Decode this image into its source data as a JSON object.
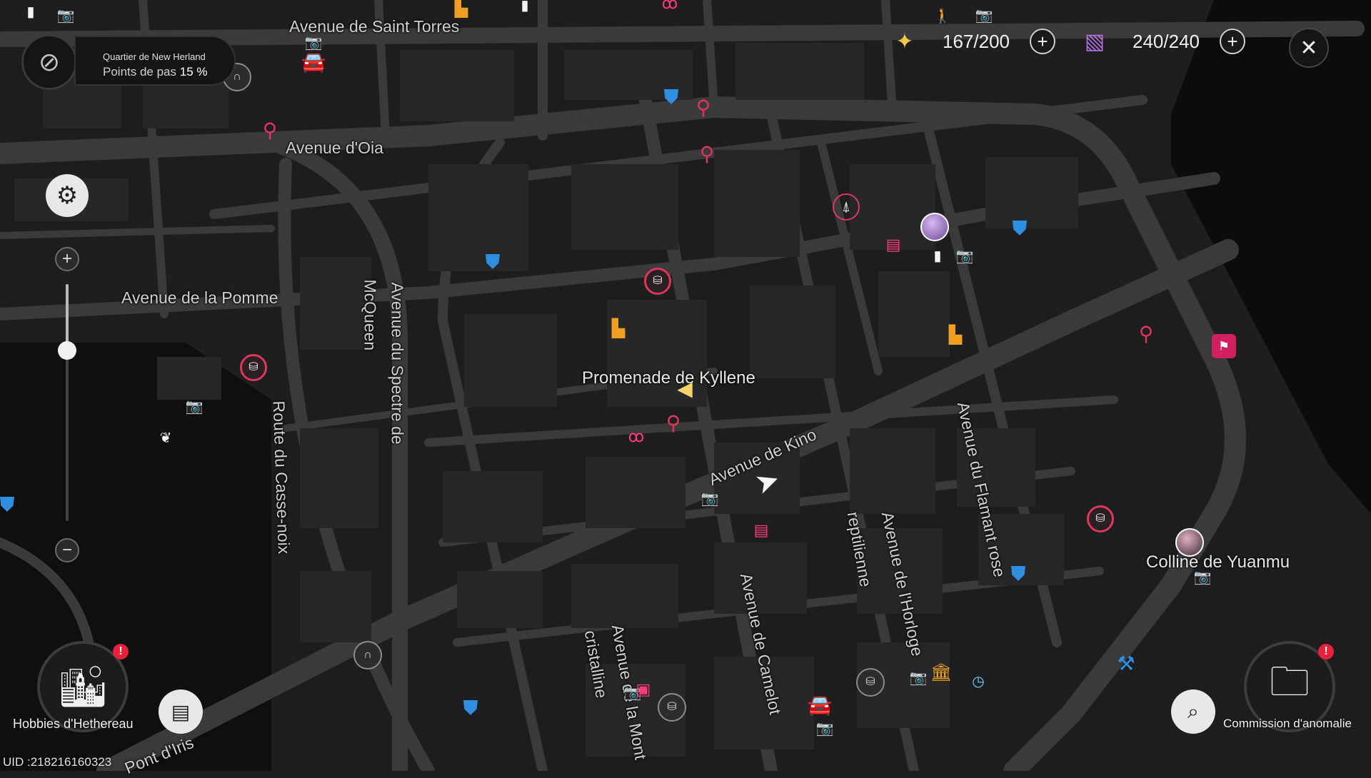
{
  "district": {
    "name": "Quartier de New Herland",
    "progress_label": "Points de pas",
    "progress_value": "15 %"
  },
  "currencies": [
    {
      "icon": "energy-crystal-icon",
      "value": "167/200"
    },
    {
      "icon": "card-stack-icon",
      "value": "240/240"
    }
  ],
  "zoom": {
    "level": 0.72
  },
  "streets": {
    "saint_torres": "Avenue de Saint Torres",
    "oia": "Avenue d'Oia",
    "pomme": "Avenue de la Pomme",
    "mcqueen": "McQueen",
    "spectre": "Avenue du Spectre de",
    "casse_noix": "Route du Casse-noix",
    "kino": "Avenue de Kino",
    "reptilienne": "reptilienne",
    "horloge": "Avenue de l'Horloge",
    "flamant": "Avenue du Flamant rose",
    "camelot": "Avenue de Camelot",
    "cristalline": "cristalline",
    "mont": "Avenue de la Mont",
    "iris": "Pont d'Iris"
  },
  "landmarks": {
    "kyllene": "Promenade de Kyllene",
    "yuanmu": "Colline de Yuanmu"
  },
  "bottom": {
    "hobbies_label": "Hobbies d'Hethereau",
    "commission_label": "Commission d'anomalie",
    "uid": "UID :218216160323"
  },
  "colors": {
    "poi_red": "#e0345a",
    "poi_blue": "#2e8fe0",
    "poi_orange": "#f0a020",
    "map_bg": "#1e1e20"
  }
}
